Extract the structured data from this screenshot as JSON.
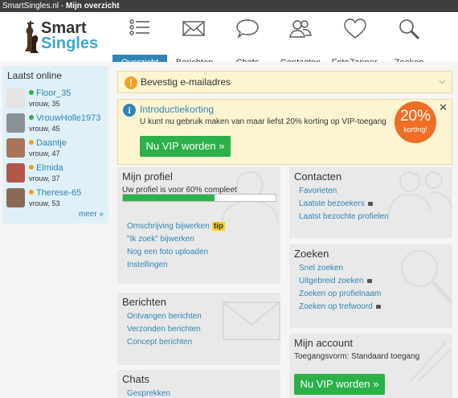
{
  "window": {
    "site": "SmartSingles.nl",
    "sep": " - ",
    "page": "Mijn overzicht"
  },
  "logo": {
    "line1": "Smart",
    "line2": "Singles"
  },
  "tabs": [
    {
      "label": "Overzicht",
      "icon": "list-icon"
    },
    {
      "label": "Berichten",
      "icon": "envelope-icon"
    },
    {
      "label": "Chats",
      "icon": "chat-bubble-icon"
    },
    {
      "label": "Contacten",
      "icon": "contacts-icon"
    },
    {
      "label": "FotoZapper",
      "icon": "heart-icon"
    },
    {
      "label": "Zoeken",
      "icon": "search-icon"
    }
  ],
  "online": {
    "title": "Laatst online",
    "users": [
      {
        "name": "Floor_35",
        "age": "vrouw, 35",
        "status": "#2bb04a"
      },
      {
        "name": "VrouwHolle1973",
        "age": "vrouw, 45",
        "status": "#2bb04a"
      },
      {
        "name": "Daantje",
        "age": "vrouw, 47",
        "status": "#f2a020"
      },
      {
        "name": "Elmida",
        "age": "vrouw, 37",
        "status": "#f2a020"
      },
      {
        "name": "Therese-65",
        "age": "vrouw, 53",
        "status": "#f2a020"
      }
    ],
    "more": "meer »"
  },
  "alert_email": {
    "text": "Bevestig e-mailadres"
  },
  "promo": {
    "title": "Introductiekorting",
    "text": "U kunt nu gebruik maken van maar liefst 20% korting op VIP-toegang",
    "badge_pct": "20%",
    "badge_label": "korting!",
    "button": "Nu VIP worden »"
  },
  "profile": {
    "title": "Mijn profiel",
    "status": "Uw profiel is voor 60% compleet",
    "progress": 0.6,
    "links": [
      "Omschrijving bijwerken",
      "\"Ik zoek\" bijwerken",
      "Nog een foto uploaden",
      "Instellingen"
    ],
    "tip": "tip"
  },
  "contacts": {
    "title": "Contacten",
    "links": [
      "Favorieten",
      "Laatste bezoekers",
      "Laatst bezochte profielen"
    ]
  },
  "search": {
    "title": "Zoeken",
    "links": [
      "Snel zoeken",
      "Uitgebreid zoeken",
      "Zoeken op profielnaam",
      "Zoeken op trefwoord"
    ]
  },
  "messages": {
    "title": "Berichten",
    "links": [
      "Ontvangen berichten",
      "Verzonden berichten",
      "Concept berichten"
    ]
  },
  "account": {
    "title": "Mijn account",
    "access": "Toegangsvorm: Standaard toegang",
    "button": "Nu VIP worden »"
  },
  "chats": {
    "title": "Chats",
    "links": [
      "Gesprekken"
    ]
  },
  "colors": {
    "accent": "#2f84b5",
    "vip_green": "#2bb04a",
    "badge_orange": "#f06d23",
    "alert_bg": "#fdf5d2"
  }
}
